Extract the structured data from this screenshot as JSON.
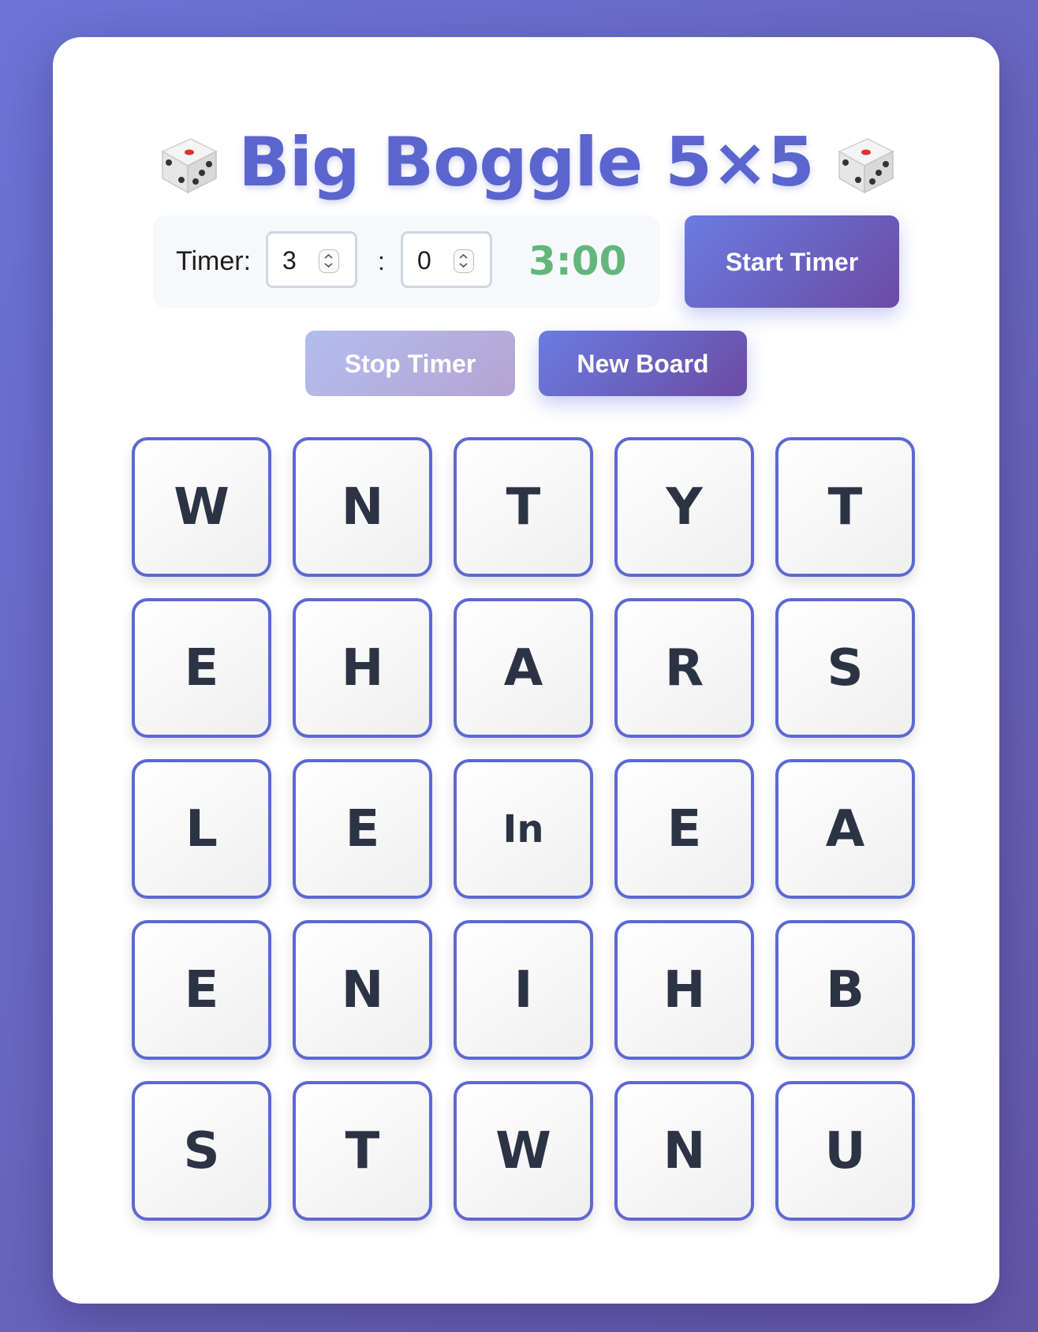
{
  "title": "Big Boggle 5×5",
  "icons": {
    "left": "dice-icon",
    "right": "dice-icon"
  },
  "timer": {
    "label": "Timer:",
    "minutes": "3",
    "separator": ":",
    "seconds": "0",
    "display": "3:00",
    "display_color": "#63b67a"
  },
  "buttons": {
    "start": "Start Timer",
    "stop": "Stop Timer",
    "new_board": "New Board"
  },
  "accent_color": "#5b65cf",
  "board": [
    [
      "W",
      "N",
      "T",
      "Y",
      "T"
    ],
    [
      "E",
      "H",
      "A",
      "R",
      "S"
    ],
    [
      "L",
      "E",
      "In",
      "E",
      "A"
    ],
    [
      "E",
      "N",
      "I",
      "H",
      "B"
    ],
    [
      "S",
      "T",
      "W",
      "N",
      "U"
    ]
  ]
}
